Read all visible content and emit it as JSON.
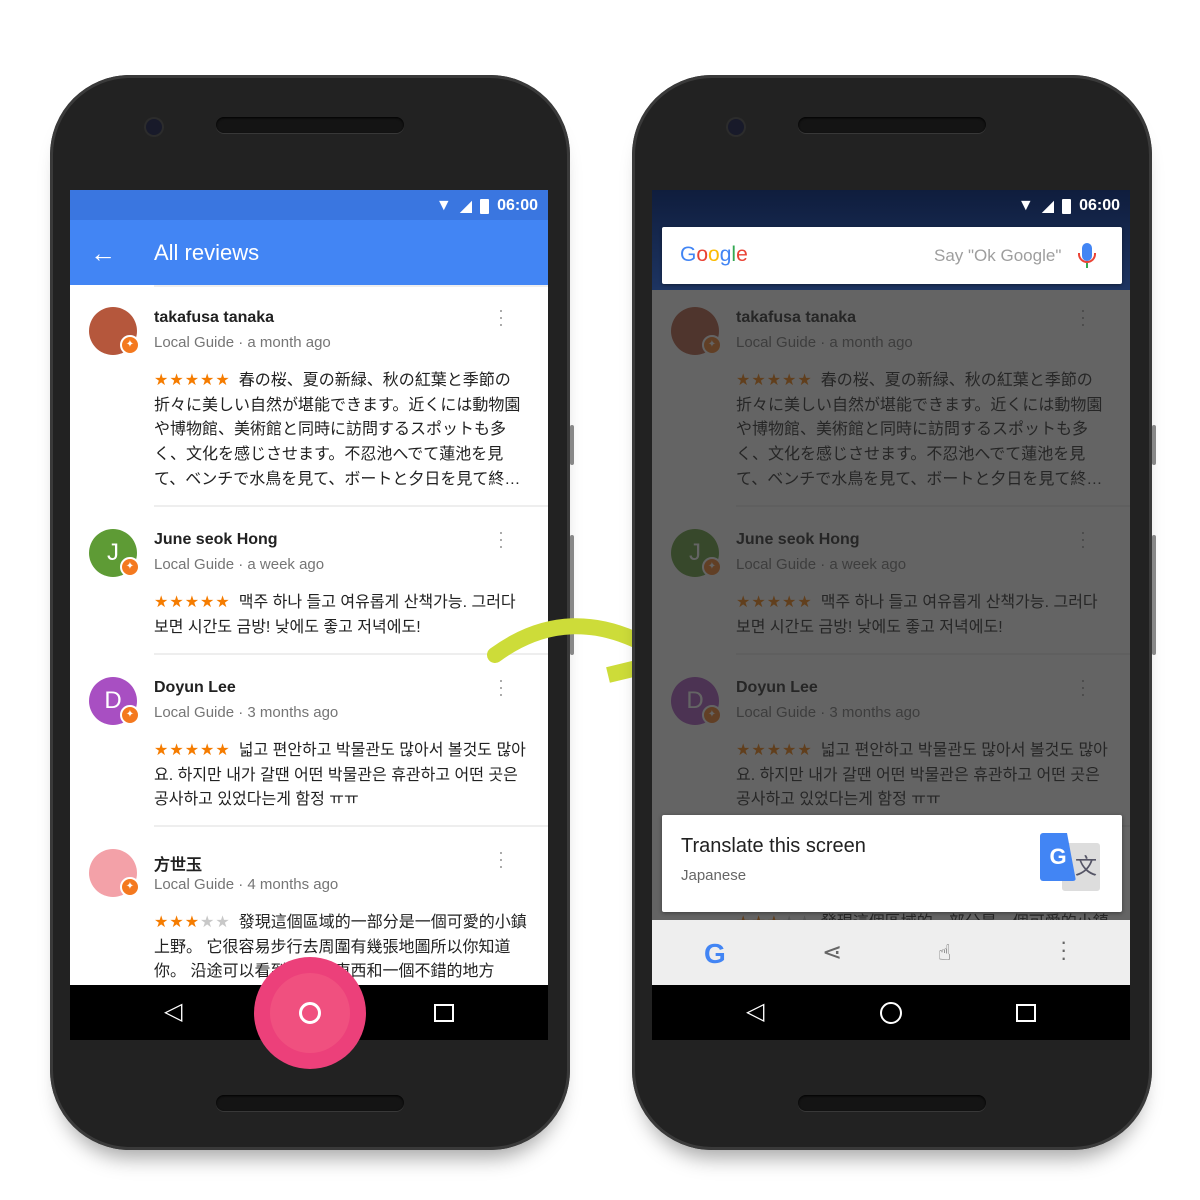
{
  "status_bar": {
    "time": "06:00"
  },
  "left_screen": {
    "toolbar": {
      "title": "All reviews"
    }
  },
  "reviews": [
    {
      "name": "takafusa tanaka",
      "meta": "Local Guide · a month ago",
      "avatar_initial": "",
      "avatar_color": "#b5573c",
      "rating": 5,
      "stars": "★★★★★",
      "stars_off": "",
      "text": "春の桜、夏の新緑、秋の紅葉と季節の折々に美しい自然が堪能できます。近くには動物園や博物館、美術館と同時に訪問するスポットも多く、文化を感じさせます。不忍池へでて蓮池を見て、ベンチで水鳥を見て、ボートと夕日を見て終…"
    },
    {
      "name": "June seok Hong",
      "meta": "Local Guide · a week ago",
      "avatar_initial": "J",
      "avatar_color": "#5e9b35",
      "rating": 5,
      "stars": "★★★★★",
      "stars_off": "",
      "text": "맥주 하나 들고 여유롭게 산책가능. 그러다 보면 시간도 금방! 낮에도 좋고 저녁에도!"
    },
    {
      "name": "Doyun Lee",
      "meta": "Local Guide · 3 months ago",
      "avatar_initial": "D",
      "avatar_color": "#a84fc2",
      "rating": 5,
      "stars": "★★★★★",
      "stars_off": "",
      "text": "넓고 편안하고 박물관도 많아서 볼것도 많아요. 하지만 내가 갈땐 어떤 박물관은 휴관하고 어떤 곳은 공사하고 있었다는게 함정 ㅠㅠ"
    },
    {
      "name": "方世玉",
      "meta": "Local Guide · 4 months ago",
      "avatar_initial": "",
      "avatar_color": "#f3a1a8",
      "rating": 3,
      "stars": "★★★",
      "stars_off": "★★",
      "text": "發現這個區域的一部分是一個可愛的小鎮上野。 它很容易步行去周圍有幾張地圖所以你知道你。 沿途可以看到有趣的東西和一個不錯的地方"
    }
  ],
  "right_screen": {
    "search": {
      "logo": "Google",
      "placeholder": "Say \"Ok Google\""
    },
    "translate_card": {
      "title": "Translate this screen",
      "language": "Japanese"
    }
  },
  "colors": {
    "toolbar": "#4285f4",
    "star": "#f57c00",
    "home_pulse": "#ec407a",
    "arrow": "#cddc39"
  }
}
